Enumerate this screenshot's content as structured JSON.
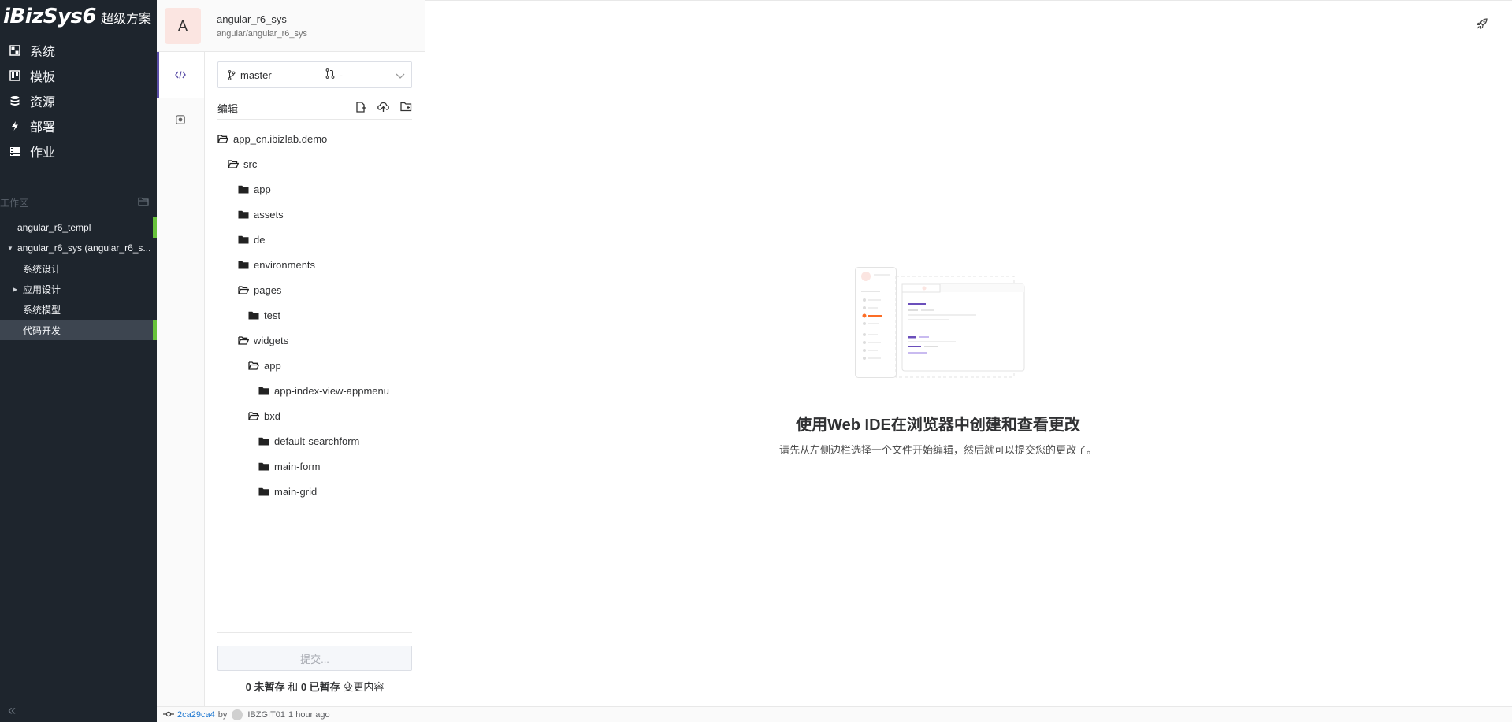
{
  "sidebar": {
    "brand": "iBizSys6",
    "brand_sub": "超级方案",
    "nav": [
      {
        "label": "系统",
        "icon": "dashboard-icon"
      },
      {
        "label": "模板",
        "icon": "template-icon"
      },
      {
        "label": "资源",
        "icon": "database-icon"
      },
      {
        "label": "部署",
        "icon": "lightning-icon"
      },
      {
        "label": "作业",
        "icon": "server-icon"
      }
    ],
    "workspace_label": "工作区",
    "tree": [
      {
        "label": "angular_r6_templ",
        "indent": 22,
        "arrow": false,
        "active": false,
        "green": true
      },
      {
        "label": "angular_r6_sys (angular_r6_s...",
        "indent": 22,
        "arrow": true,
        "arrow_dir": "down",
        "active": false,
        "green": false
      },
      {
        "label": "系统设计",
        "indent": 29,
        "arrow": false,
        "active": false,
        "green": false
      },
      {
        "label": "应用设计",
        "indent": 29,
        "arrow": true,
        "arrow_dir": "right",
        "active": false,
        "green": false
      },
      {
        "label": "系统模型",
        "indent": 29,
        "arrow": false,
        "active": false,
        "green": false
      },
      {
        "label": "代码开发",
        "indent": 29,
        "arrow": false,
        "active": true,
        "green": true
      }
    ]
  },
  "project": {
    "avatar_letter": "A",
    "name": "angular_r6_sys",
    "path": "angular/angular_r6_sys"
  },
  "branch": {
    "name": "master",
    "mr": "-"
  },
  "edit_label": "编辑",
  "file_tree": [
    {
      "name": "app_cn.ibizlab.demo",
      "level": 0,
      "open": true
    },
    {
      "name": "src",
      "level": 1,
      "open": true
    },
    {
      "name": "app",
      "level": 2,
      "open": false
    },
    {
      "name": "assets",
      "level": 2,
      "open": false
    },
    {
      "name": "de",
      "level": 2,
      "open": false
    },
    {
      "name": "environments",
      "level": 2,
      "open": false
    },
    {
      "name": "pages",
      "level": 2,
      "open": true
    },
    {
      "name": "test",
      "level": 3,
      "open": false
    },
    {
      "name": "widgets",
      "level": 2,
      "open": true
    },
    {
      "name": "app",
      "level": 3,
      "open": true
    },
    {
      "name": "app-index-view-appmenu",
      "level": 4,
      "open": false
    },
    {
      "name": "bxd",
      "level": 3,
      "open": true
    },
    {
      "name": "default-searchform",
      "level": 4,
      "open": false
    },
    {
      "name": "main-form",
      "level": 4,
      "open": false
    },
    {
      "name": "main-grid",
      "level": 4,
      "open": false
    }
  ],
  "commit": {
    "button_label": "提交...",
    "unstaged_count": "0",
    "unstaged_label": "未暂存",
    "and": "和",
    "staged_count": "0",
    "staged_label": "已暂存",
    "changes_label": "变更内容"
  },
  "empty_state": {
    "title": "使用Web IDE在浏览器中创建和查看更改",
    "desc": "请先从左侧边栏选择一个文件开始编辑，然后就可以提交您的更改了。"
  },
  "status": {
    "sha": "2ca29ca4",
    "by": "by",
    "user": "IBZGIT01",
    "time": "1 hour ago"
  },
  "colors": {
    "sidebar_bg": "#1e252d",
    "active_green": "#67c23a",
    "accent_purple": "#5b4fa8",
    "avatar_bg": "#fbe5e1"
  }
}
